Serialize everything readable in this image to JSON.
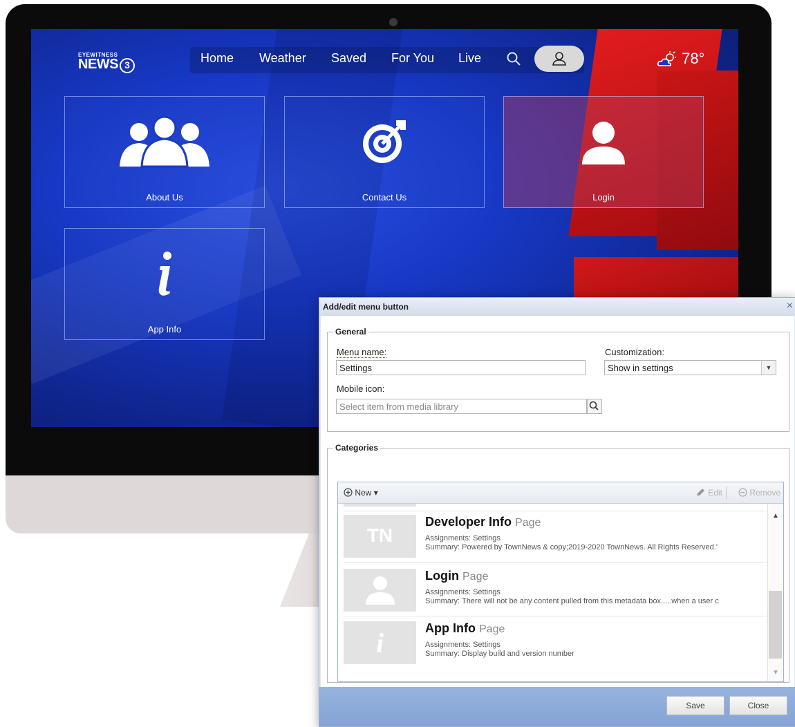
{
  "site": {
    "logo_small": "EYEWITNESS",
    "logo_big": "NEWS",
    "logo_number": "3",
    "nav": [
      "Home",
      "Weather",
      "Saved",
      "For You",
      "Live"
    ],
    "temperature": "78°",
    "tiles": [
      {
        "label": "About Us",
        "icon": "people-icon"
      },
      {
        "label": "Contact Us",
        "icon": "target-icon"
      },
      {
        "label": "Login",
        "icon": "person-icon"
      },
      {
        "label": "App Info",
        "icon": "info-icon"
      }
    ],
    "colors": {
      "brand_blue": "#1738c4",
      "brand_red": "#e41d1d"
    }
  },
  "dialog": {
    "title": "Add/edit menu button",
    "close": "×",
    "general": {
      "legend": "General",
      "menu_name_label": "Menu name:",
      "menu_name_value": "Settings",
      "customization_label": "Customization:",
      "customization_value": "Show in settings",
      "mobile_icon_label": "Mobile icon:",
      "mobile_icon_placeholder": "Select item from media library"
    },
    "categories": {
      "legend": "Categories",
      "new_label": "New",
      "edit_label": "Edit",
      "remove_label": "Remove",
      "items": [
        {
          "title": "Developer Info",
          "type": "Page",
          "thumb_text": "TN",
          "assignments": "Assignments: Settings",
          "summary": "Summary: Powered by TownNews & copy;2019-2020 TownNews. All Rights Reserved.'"
        },
        {
          "title": "Login",
          "type": "Page",
          "thumb_text": "",
          "assignments": "Assignments: Settings",
          "summary": "Summary: There will not be any content pulled from this metadata box.....when a user c"
        },
        {
          "title": "App Info",
          "type": "Page",
          "thumb_text": "i",
          "assignments": "Assignments: Settings",
          "summary": "Summary: Display build and version number"
        }
      ]
    },
    "buttons": {
      "save": "Save",
      "close": "Close"
    }
  }
}
